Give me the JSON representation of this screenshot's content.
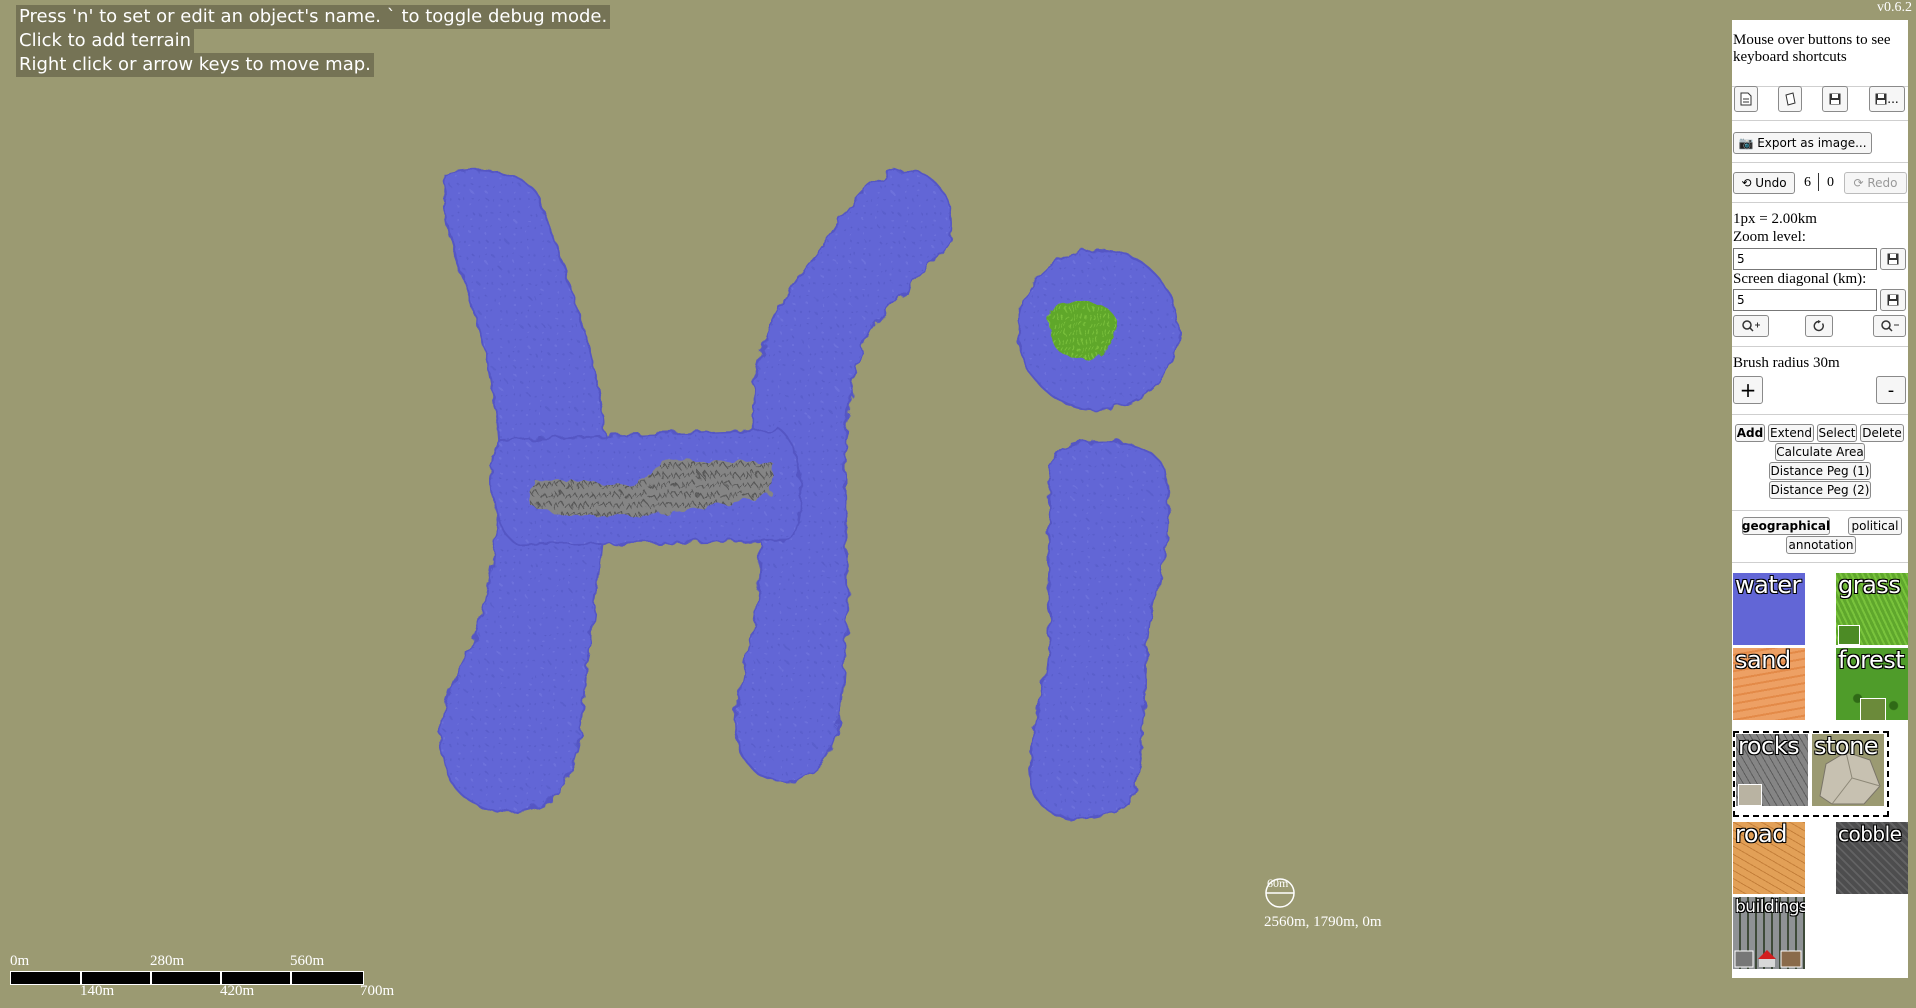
{
  "version": "v0.6.2",
  "help_lines": [
    "Press 'n' to set or edit an object's name. ` to toggle debug mode.",
    "Click to add terrain",
    "Right click or arrow keys to move map."
  ],
  "scale_bar": {
    "top_labels": [
      "0m",
      "280m",
      "560m"
    ],
    "bottom_labels": [
      "140m",
      "420m",
      "700m"
    ]
  },
  "cursor": {
    "radius_label": "60m",
    "coords": "2560m, 1790m, 0m"
  },
  "panel": {
    "hint": "Mouse over buttons to see keyboard shortcuts",
    "file_buttons": [
      "new-file-icon",
      "open-file-icon",
      "save-icon",
      "save-as-icon"
    ],
    "save_as_suffix": "...",
    "export_label": "📷 Export as image...",
    "undo_label": "⟲ Undo",
    "undo_count": "6",
    "redo_count": "0",
    "redo_label": "⟳ Redo",
    "scale_text": "1px = 2.00km",
    "zoom_label": "Zoom level:",
    "zoom_value": "5",
    "diag_label": "Screen diagonal (km):",
    "diag_value": "5",
    "brush_label": "Brush radius 30m",
    "brush_plus": "+",
    "brush_minus": "-",
    "modes": [
      "Add",
      "Extend",
      "Select",
      "Delete"
    ],
    "tools": [
      "Calculate Area",
      "Distance Peg (1)",
      "Distance Peg (2)"
    ],
    "categories": [
      "geographical",
      "political",
      "annotation"
    ],
    "terrains": [
      "water",
      "grass",
      "sand",
      "forest",
      "rocks",
      "stone",
      "road",
      "cobble",
      "buildings"
    ]
  },
  "colors": {
    "background": "#9b9a72",
    "water": "#6266d6",
    "grass": "#5fa72c",
    "sand": "#eda064",
    "forest": "#4f9c2a",
    "rocks": "#858585",
    "road": "#e2a057",
    "cobble": "#4d4d4e",
    "buildings": "#8f9295"
  }
}
